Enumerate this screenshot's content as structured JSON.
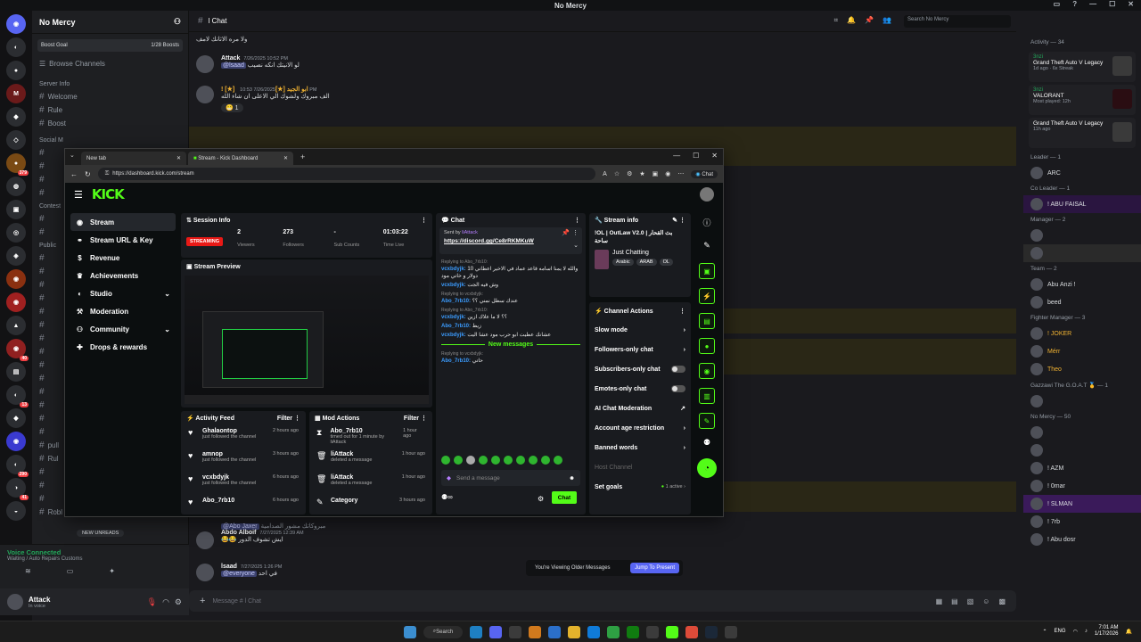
{
  "discord": {
    "server_name": "No Mercy",
    "channel_name": "l Chat",
    "search_placeholder": "Search No Mercy",
    "boost_goal": "Boost Goal",
    "boost_count": "1/28 Boosts",
    "browse_channels": "Browse Channels",
    "channels": [
      {
        "label": "Server Info",
        "kind": "cat"
      },
      {
        "label": "Welcome",
        "kind": "ch"
      },
      {
        "label": "Rule",
        "kind": "ch"
      },
      {
        "label": "Boost",
        "kind": "ch"
      },
      {
        "label": "Social M",
        "kind": "cat"
      },
      {
        "label": "Contest",
        "kind": "cat"
      },
      {
        "label": "Public",
        "kind": "cat"
      },
      {
        "label": "pull",
        "kind": "ch"
      },
      {
        "label": "Rul",
        "kind": "ch"
      },
      {
        "label": "Robl",
        "kind": "ch"
      }
    ],
    "new_unreads": "NEW UNREADS",
    "voice_connected": "Voice Connected",
    "voice_sub": "Waiting / Auto Repairs Customs",
    "username": "Attack",
    "user_status": "In voice",
    "composer_placeholder": "Message # l Chat",
    "older_text": "You're Viewing Older Messages",
    "jump_label": "Jump To Present",
    "messages": [
      {
        "author": "",
        "time": "",
        "text": "ولا مره الاثانك لامف"
      },
      {
        "author": "Attack",
        "time": "7/26/2025 10:52 PM",
        "mention": "@lsaad",
        "text": "لو الانيتك انكه نصيب"
      },
      {
        "author": "! [★] ابو الجيد [★]",
        "time": "7/26/2025 10:53 PM",
        "text": "الف مبروك ولشوك الي الاعلى ان شاء الله",
        "reaction": "1"
      },
      {
        "author": "@Abo Jaxer",
        "time": "",
        "text": "مبروكاتك مشور الصدامية"
      },
      {
        "author": "Abdo Alboif",
        "time": "7/27/2025 12:39 AM",
        "text": "😂😂 ايش تشوف الدور"
      },
      {
        "author": "lsaad",
        "time": "7/27/2025 1:26 PM",
        "mention": "@everyone",
        "text": "في احد"
      }
    ],
    "members": {
      "activity_header": "Activity — 34",
      "activities": [
        {
          "user": "3nzi",
          "game": "Grand Theft Auto V Legacy",
          "sub": "1d ago · 6x Streak"
        },
        {
          "user": "3nzi",
          "game": "VALORANT",
          "sub": "Most played: 12h"
        },
        {
          "user": "",
          "game": "Grand Theft Auto V Legacy",
          "sub": "11h ago"
        }
      ],
      "groups": [
        {
          "header": "Leader — 1",
          "names": [
            "ARC"
          ]
        },
        {
          "header": "Co Leader — 1",
          "names": [
            "! ABU FAISAL"
          ]
        },
        {
          "header": "Manager — 2",
          "names": [
            "",
            ""
          ]
        },
        {
          "header": "Team — 2",
          "names": [
            "Abu Anzi !",
            "beed"
          ]
        },
        {
          "header": "Fighter Manager — 3",
          "names": [
            "! JOKER",
            "Mérr",
            "Theo"
          ]
        },
        {
          "header": "Gazzawi The G.O.A.T 🥇 — 1",
          "names": [
            ""
          ]
        },
        {
          "header": "No Mercy — 50",
          "names": [
            "",
            "",
            "! AZM",
            "! 0mar",
            "! SLMAN",
            "! 7rb",
            "! Abu dosr"
          ]
        }
      ]
    }
  },
  "browser": {
    "tabs": [
      "New tab",
      "Stream - Kick Dashboard"
    ],
    "url": "https://dashboard.kick.com/stream",
    "chat_button": "Chat"
  },
  "kick": {
    "logo": "KICK",
    "nav": [
      "Stream",
      "Stream URL & Key",
      "Revenue",
      "Achievements",
      "Studio",
      "Moderation",
      "Community",
      "Drops & rewards"
    ],
    "session": {
      "title": "Session Info",
      "status": "STREAMING",
      "viewers": "2",
      "viewers_label": "Viewers",
      "followers": "273",
      "followers_label": "Followers",
      "subs": "-",
      "subs_label": "Sub Counts",
      "time": "01:03:22",
      "time_label": "Time Live"
    },
    "preview_title": "Stream Preview",
    "activity": {
      "title": "Activity Feed",
      "filter": "Filter",
      "rows": [
        {
          "name": "Ghalaontop",
          "sub": "just followed the channel",
          "time": "2 hours ago"
        },
        {
          "name": "amnop",
          "sub": "just followed the channel",
          "time": "3 hours ago"
        },
        {
          "name": "vcxbdyjk",
          "sub": "just followed the channel",
          "time": "6 hours ago"
        },
        {
          "name": "Abo_7rb10",
          "sub": "",
          "time": "6 hours ago"
        }
      ]
    },
    "modactions": {
      "title": "Mod Actions",
      "filter": "Filter",
      "rows": [
        {
          "name": "Abo_7rb10",
          "sub": "timed out for 1 minute by liAttack",
          "time": "1 hour ago"
        },
        {
          "name": "liAttack",
          "sub": "deleted a message",
          "time": "1 hour ago"
        },
        {
          "name": "liAttack",
          "sub": "deleted a message",
          "time": "1 hour ago"
        },
        {
          "name": "Category",
          "sub": "",
          "time": "3 hours ago"
        }
      ]
    },
    "chat": {
      "title": "Chat",
      "pinned_by": "Sent by",
      "pinned_user": "liAttack",
      "pinned_link": "https://discord.gg/Ce8rRKMKuW",
      "new_messages": "New messages",
      "input_placeholder": "Send a message",
      "send_label": "Chat",
      "lines": [
        {
          "reply": "Replying to Abo_7rb10:",
          "user": "vcxbdyjk:",
          "text": "والله لا يمنا اسامه قاعد عماد في الاخير اعطاني 10 دولار و خاتي مود"
        },
        {
          "reply": "",
          "user": "vcxbdyjk:",
          "text": "وش فيه الجت"
        },
        {
          "reply": "Replying to vcxbdyjk:",
          "user": "Abo_7rb10:",
          "text": "عندك سطل نمني ؟؟"
        },
        {
          "reply": "Replying to Abo_7rb10:",
          "user": "vcxbdyjk:",
          "text": "؟؟ لا ما علاك ازين"
        },
        {
          "reply": "",
          "user": "Abo_7rb10:",
          "text": "زيط"
        },
        {
          "reply": "",
          "user": "vcxbdyjk:",
          "text": "عشانك عطيت ابو حرب مود عشا اليت"
        },
        {
          "reply": "Replying to vcxbdyjk:",
          "user": "Abo_7rb10:",
          "text": "حاتي"
        }
      ]
    },
    "streaminfo": {
      "title": "Stream info",
      "stream_title": "!OL | OutLaw V2.0 | بث القحار ساحة",
      "category": "Just Chatting",
      "tags": [
        "Arabic",
        "ARAB",
        "OL"
      ]
    },
    "channelactions": {
      "title": "Channel Actions",
      "items": [
        {
          "label": "Slow mode",
          "control": "chevron"
        },
        {
          "label": "Followers-only chat",
          "control": "chevron"
        },
        {
          "label": "Subscribers-only chat",
          "control": "toggle"
        },
        {
          "label": "Emotes-only chat",
          "control": "toggle"
        },
        {
          "label": "AI Chat Moderation",
          "control": "link"
        },
        {
          "label": "Account age restriction",
          "control": "chevron"
        },
        {
          "label": "Banned words",
          "control": "chevron"
        }
      ],
      "host_channel": "Host Channel",
      "set_goals": "Set goals",
      "goals_status": "1 active"
    }
  },
  "taskbar": {
    "search": "Search",
    "lang": "ENG",
    "time": "7:01 AM",
    "date": "1/17/2026"
  },
  "colors": {
    "kick_green": "#53fc18",
    "live_red": "#e91916",
    "discord_blurple": "#5865f2"
  }
}
